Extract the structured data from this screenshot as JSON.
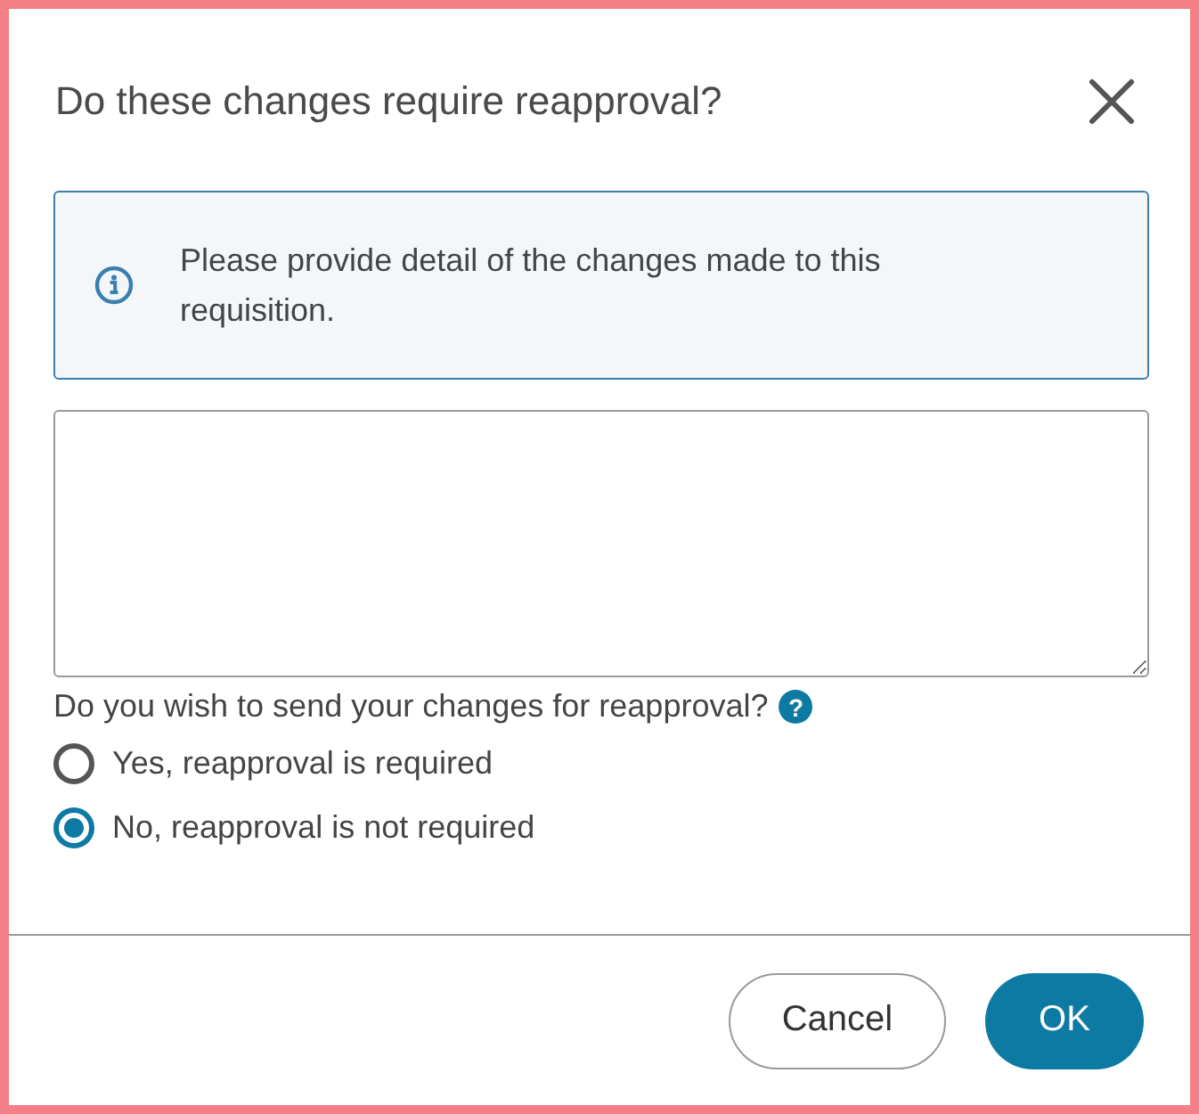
{
  "dialog": {
    "title": "Do these changes require reapproval?"
  },
  "info": {
    "message": "Please provide detail of the changes made to this requisition."
  },
  "question": {
    "label": "Do you wish to send your changes for reapproval?",
    "help": "?"
  },
  "options": [
    {
      "label": "Yes, reapproval is required",
      "selected": false
    },
    {
      "label": "No, reapproval is not required",
      "selected": true
    }
  ],
  "buttons": [
    {
      "label": "Cancel",
      "kind": "secondary"
    },
    {
      "label": "OK",
      "kind": "primary"
    }
  ]
}
